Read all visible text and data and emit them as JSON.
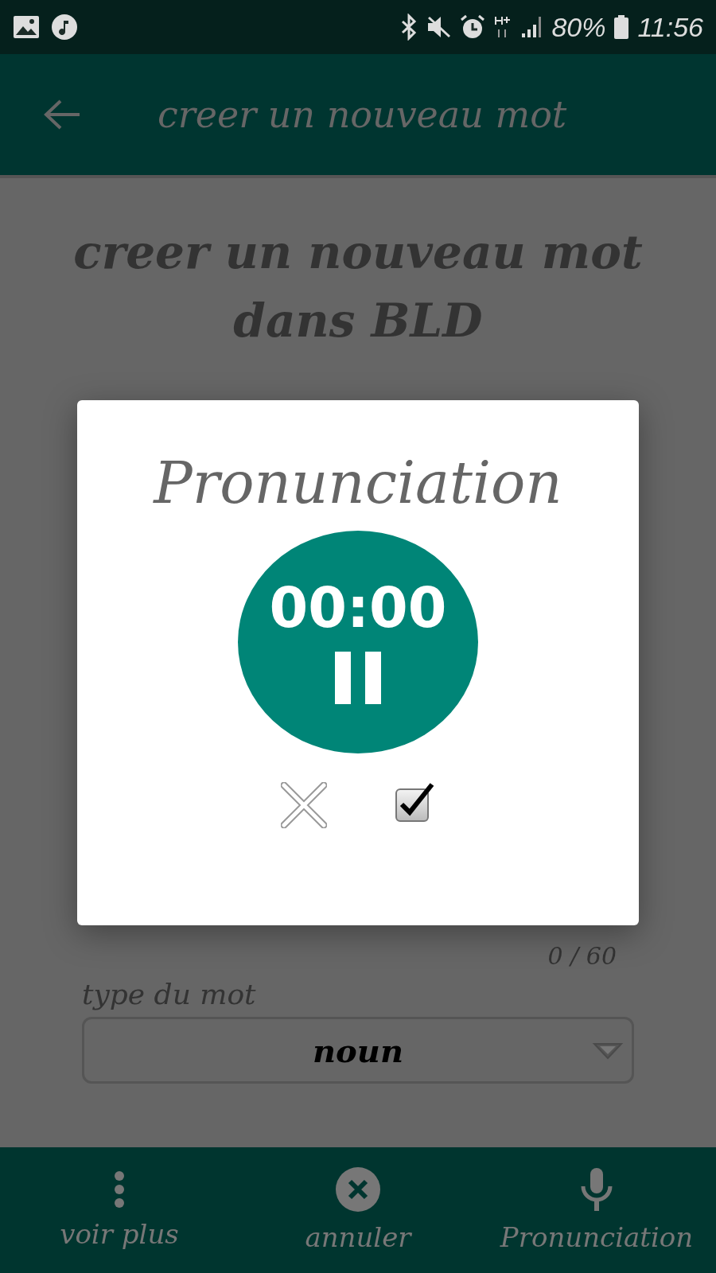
{
  "status_bar": {
    "battery": "80%",
    "time": "11:56"
  },
  "app_bar": {
    "title": "creer un nouveau mot"
  },
  "page": {
    "title": "creer un nouveau mot dans BLD",
    "counter": "0 / 60",
    "type_label": "type du mot",
    "type_value": "noun"
  },
  "dialog": {
    "title": "Pronunciation",
    "timer": "00:00"
  },
  "bottom_bar": [
    {
      "label": "voir plus"
    },
    {
      "label": "annuler"
    },
    {
      "label": "Pronunciation"
    }
  ]
}
